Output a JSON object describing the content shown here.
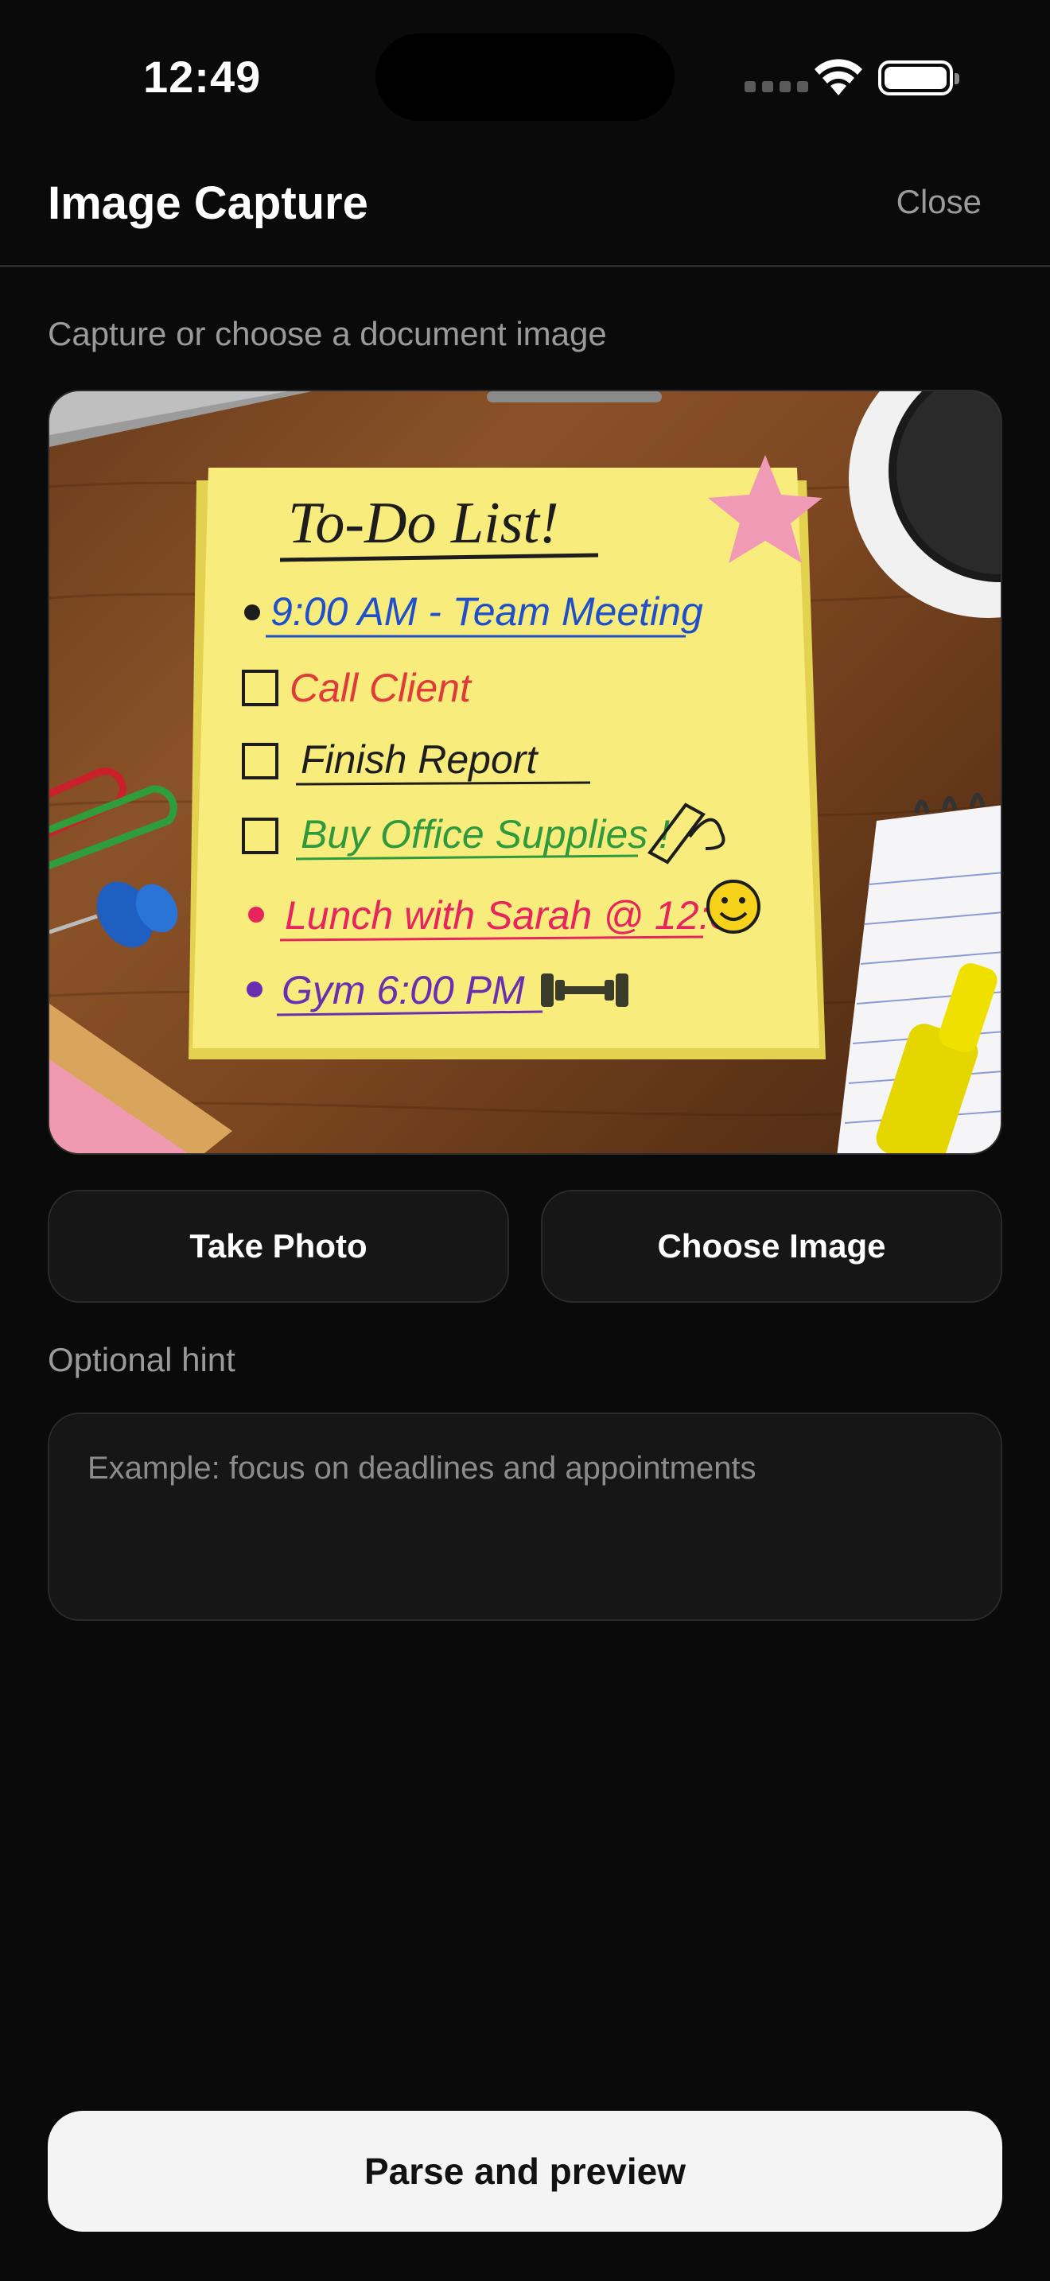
{
  "status_bar": {
    "time": "12:49"
  },
  "header": {
    "title": "Image Capture",
    "close_label": "Close"
  },
  "subtitle": "Capture or choose a document image",
  "preview": {
    "note_title": "To-Do List!",
    "items": [
      {
        "text": "9:00 AM - Team Meeting",
        "marker": "bullet",
        "color": "#1f4fc9"
      },
      {
        "text": "Call Client",
        "marker": "checkbox",
        "color": "#e03a3a"
      },
      {
        "text": "Finish Report",
        "marker": "checkbox",
        "color": "#1d1d1d"
      },
      {
        "text": "Buy Office Supplies !",
        "marker": "checkbox",
        "color": "#2f9a3c"
      },
      {
        "text": "Lunch with Sarah @ 12:30",
        "marker": "bullet",
        "color": "#e8245f"
      },
      {
        "text": "Gym 6:00 PM",
        "marker": "bullet",
        "color": "#6a2fb0"
      }
    ]
  },
  "actions": {
    "take_photo": "Take Photo",
    "choose_image": "Choose Image"
  },
  "hint": {
    "label": "Optional hint",
    "placeholder": "Example: focus on deadlines and appointments",
    "value": ""
  },
  "primary": {
    "parse_label": "Parse and preview"
  },
  "colors": {
    "background": "#0a0a0a",
    "surface": "#161616",
    "primary_button": "#f4f4f4"
  }
}
